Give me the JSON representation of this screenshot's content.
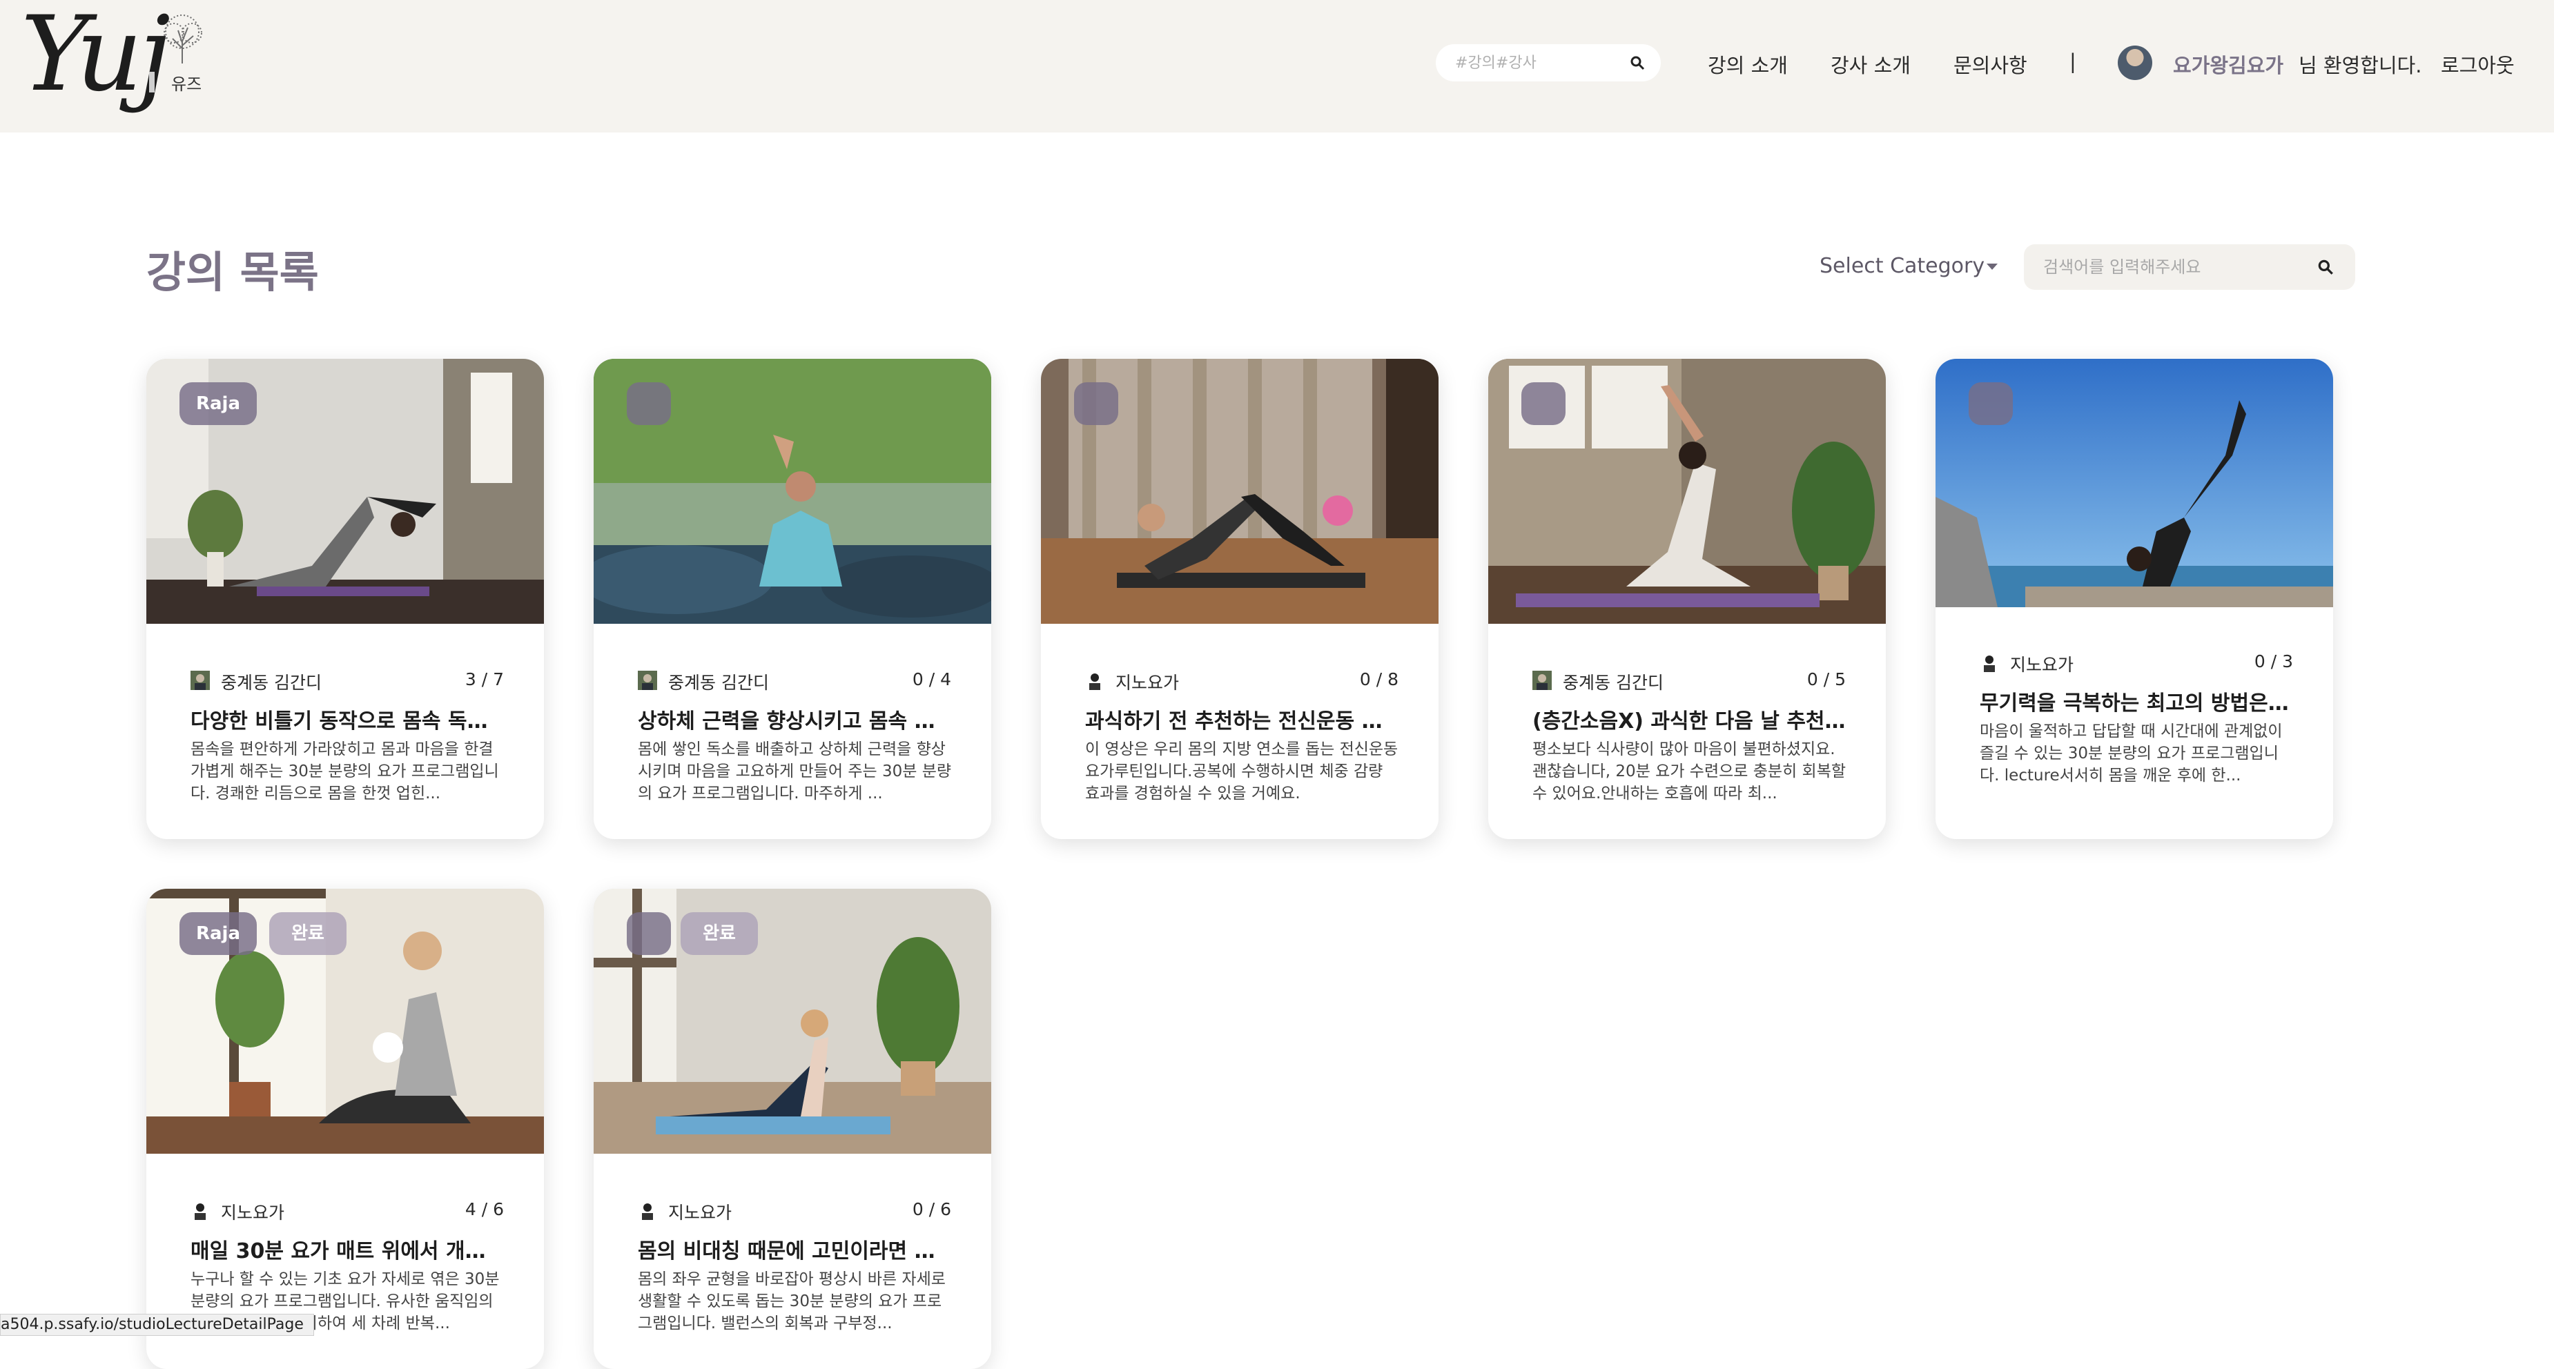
{
  "header": {
    "logo_text": "Yuj",
    "logo_sub": "유즈",
    "search_placeholder": "#강의#강사",
    "nav": [
      "강의 소개",
      "강사 소개",
      "문의사항"
    ],
    "divider": "|",
    "user_name": "요가왕김요가",
    "welcome": "님 환영합니다.",
    "logout": "로그아웃"
  },
  "main": {
    "title": "강의 목록",
    "category_label": "Select Category",
    "search_placeholder": "검색어를 입력해주세요"
  },
  "cards": [
    {
      "badge": "Raja",
      "done": "",
      "teacher": "중계동 김간디",
      "progress": "3 / 7",
      "title": "다양한 비틀기 동작으로 몸속 독소...",
      "desc": "몸속을 편안하게 가라앉히고 몸과 마음을 한결 가볍게 해주는 30분 분량의 요가 프로그램입니다. 경쾌한 리듬으로 몸을 한껏 업힌..."
    },
    {
      "badge": "",
      "done": "",
      "teacher": "중계동 김간디",
      "progress": "0 / 4",
      "title": "상하체 근력을 향상시키고 몸속 독...",
      "desc": "몸에 쌓인 독소를 배출하고 상하체 근력을 향상 시키며 마음을 고요하게 만들어 주는 30분 분량의 요가 프로그램입니다. 마주하게 ..."
    },
    {
      "badge": "",
      "done": "",
      "teacher": "지노요가",
      "progress": "0 / 8",
      "title": "과식하기 전 추천하는 전신운동 요...",
      "desc": "이 영상은 우리 몸의 지방 연소를 돕는 전신운동 요가루틴입니다.공복에 수행하시면 체중 감량 효과를 경험하실 수 있을 거예요."
    },
    {
      "badge": "",
      "done": "",
      "teacher": "중계동 김간디",
      "progress": "0 / 5",
      "title": "(층간소음X) 과식한 다음 날 추천하...",
      "desc": "평소보다 식사량이 많아 마음이 불편하셨지요.괜찮습니다, 20분 요가 수련으로 충분히 회복할 수 있어요.안내하는 호흡에 따라 최..."
    },
    {
      "badge": "",
      "done": "",
      "teacher": "지노요가",
      "progress": "0 / 3",
      "title": "무기력을 극복하는 최고의 방법은 ...",
      "desc": "마음이 울적하고 답답할 때 시간대에 관계없이 즐길 수 있는 30분 분량의 요가 프로그램입니다. lecture서서히 몸을 깨운 후에 한..."
    },
    {
      "badge": "Raja",
      "done": "완료",
      "teacher": "지노요가",
      "progress": "4 / 6",
      "title": "매일 30분 요가 매트 위에서 개운하...",
      "desc": "누구나 할 수 있는 기초 요가 자세로 엮은 30분 분량의 요가 프로그램입니다. 유사한 움직임의 루틴을 순도를 달리하여 세 차례 반복..."
    },
    {
      "badge": "",
      "done": "완료",
      "teacher": "지노요가",
      "progress": "0 / 6",
      "title": "몸의 비대칭 때문에 고민이라면 꼭 ...",
      "desc": "몸의 좌우 균형을 바로잡아 평상시 바른 자세로 생활할 수 있도록 돕는 30분 분량의 요가 프로그램입니다. 밸런스의 회복과 구부정..."
    }
  ],
  "status_url": "a504.p.ssafy.io/studioLectureDetailPage"
}
